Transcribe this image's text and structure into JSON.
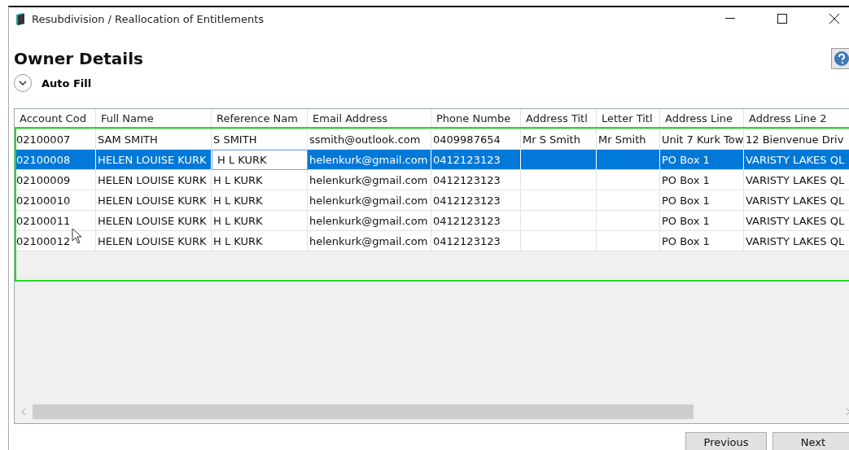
{
  "window": {
    "title": "Resubdivision / Reallocation of Entitlements"
  },
  "page": {
    "heading": "Owner Details",
    "auto_fill": {
      "label": "Auto Fill",
      "expanded": false
    }
  },
  "table": {
    "columns": [
      "Account Cod",
      "Full Name",
      "Reference Nam",
      "Email Address",
      "Phone Numbe",
      "Address Titl",
      "Letter Titl",
      "Address Line",
      "Address Line 2"
    ],
    "rows": [
      {
        "cells": [
          "02100007",
          "SAM SMITH",
          "S SMITH",
          "ssmith@outlook.com",
          "0409987654",
          "Mr S Smith",
          "Mr Smith",
          "Unit 7 Kurk Tow",
          "12 Bienvenue Driv"
        ],
        "selected": false,
        "editing": false
      },
      {
        "cells": [
          "02100008",
          "HELEN LOUISE KURK",
          "H L KURK",
          "helenkurk@gmail.com",
          "0412123123",
          "",
          "",
          "PO Box 1",
          "VARISTY LAKES QL"
        ],
        "selected": true,
        "editing": true
      },
      {
        "cells": [
          "02100009",
          "HELEN LOUISE KURK",
          "H L KURK",
          "helenkurk@gmail.com",
          "0412123123",
          "",
          "",
          "PO Box 1",
          "VARISTY LAKES QL"
        ],
        "selected": false,
        "editing": false
      },
      {
        "cells": [
          "02100010",
          "HELEN LOUISE KURK",
          "H L KURK",
          "helenkurk@gmail.com",
          "0412123123",
          "",
          "",
          "PO Box 1",
          "VARISTY LAKES QL"
        ],
        "selected": false,
        "editing": false
      },
      {
        "cells": [
          "02100011",
          "HELEN LOUISE KURK",
          "H L KURK",
          "helenkurk@gmail.com",
          "0412123123",
          "",
          "",
          "PO Box 1",
          "VARISTY LAKES QL"
        ],
        "selected": false,
        "editing": false
      },
      {
        "cells": [
          "02100012",
          "HELEN LOUISE KURK",
          "H L KURK",
          "helenkurk@gmail.com",
          "0412123123",
          "",
          "",
          "PO Box 1",
          "VARISTY LAKES QL"
        ],
        "selected": false,
        "editing": false
      }
    ]
  },
  "buttons": [
    "Previous",
    "Next"
  ]
}
